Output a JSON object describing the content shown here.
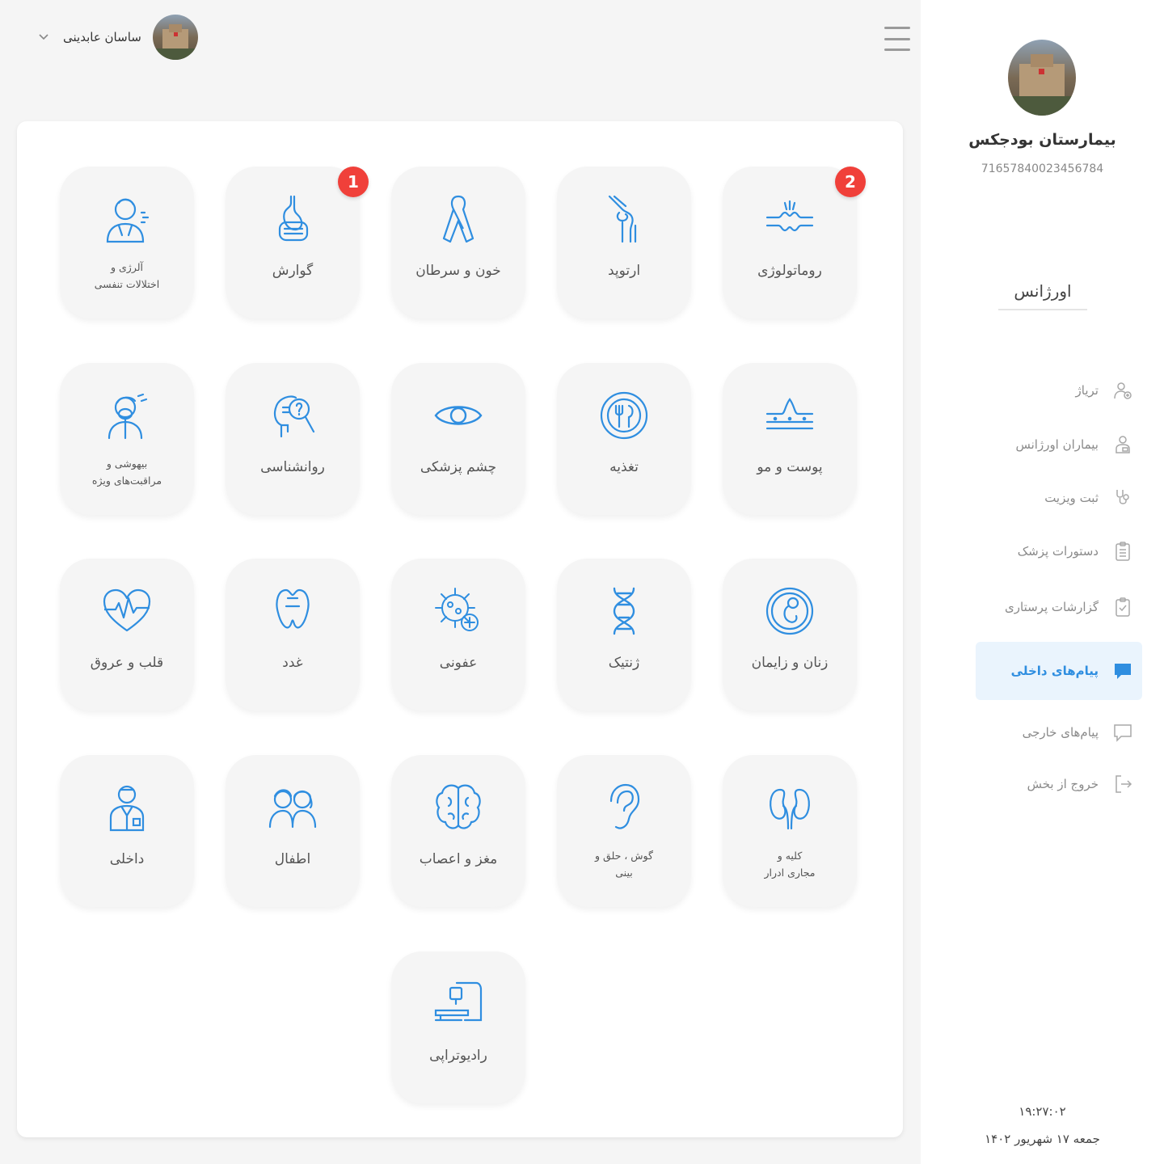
{
  "header": {
    "user_name": "ساسان عابدینی"
  },
  "colors": {
    "accent": "#2f8ee0",
    "badge": "#f0403a",
    "tile_bg": "#f5f5f5"
  },
  "departments": [
    {
      "label": "روماتولوژی",
      "icon": "rheumatology-icon",
      "badge": "2"
    },
    {
      "label": "ارتوپد",
      "icon": "knee-joint-icon"
    },
    {
      "label": "خون و سرطان",
      "icon": "cancer-ribbon-icon"
    },
    {
      "label": "گوارش",
      "icon": "stomach-icon",
      "badge": "1"
    },
    {
      "label": "آلرژی و\nاختلالات تنفسی",
      "icon": "allergy-icon"
    },
    {
      "label": "پوست و مو",
      "icon": "skin-icon"
    },
    {
      "label": "تغذیه",
      "icon": "plate-cutlery-icon"
    },
    {
      "label": "چشم پزشکی",
      "icon": "eye-icon"
    },
    {
      "label": "روانشناسی",
      "icon": "psychology-head-icon"
    },
    {
      "label": "بیهوشی و\nمراقبت‌های ویژه",
      "icon": "anesthesia-icon"
    },
    {
      "label": "زنان و زایمان",
      "icon": "fetus-icon"
    },
    {
      "label": "ژنتیک",
      "icon": "dna-icon"
    },
    {
      "label": "عفونی",
      "icon": "virus-icon"
    },
    {
      "label": "غدد",
      "icon": "thyroid-icon"
    },
    {
      "label": "قلب و عروق",
      "icon": "heart-pulse-icon"
    },
    {
      "label": "کلیه و\nمجاری ادرار",
      "icon": "kidney-icon"
    },
    {
      "label": "گوش ، حلق و\nبینی",
      "icon": "ear-icon"
    },
    {
      "label": "مغز و اعصاب",
      "icon": "brain-icon"
    },
    {
      "label": "اطفال",
      "icon": "children-icon"
    },
    {
      "label": "داخلی",
      "icon": "doctor-icon"
    },
    {
      "label": "رادیوتراپی",
      "icon": "radiotherapy-machine-icon"
    }
  ],
  "sidebar": {
    "hospital_name": "بیمارستان بودجکس",
    "hospital_code": "71657840023456784",
    "section_title": "اورژانس",
    "items": [
      {
        "label": "تریاژ",
        "icon": "user-add-icon"
      },
      {
        "label": "بیماران اورژانس",
        "icon": "patient-icon"
      },
      {
        "label": "ثبت ویزیت",
        "icon": "stethoscope-icon"
      },
      {
        "label": "دستورات پزشک",
        "icon": "clipboard-list-icon"
      },
      {
        "label": "گزارشات پرستاری",
        "icon": "clipboard-check-icon"
      },
      {
        "label": "پیام‌های داخلی",
        "icon": "chat-filled-icon",
        "active": true
      },
      {
        "label": "پیام‌های خارجی",
        "icon": "chat-outline-icon"
      },
      {
        "label": "خروج از بخش",
        "icon": "logout-icon"
      }
    ],
    "time": "۱۹:۲۷:۰۲",
    "date": "جمعه ۱۷ شهریور ۱۴۰۲"
  }
}
